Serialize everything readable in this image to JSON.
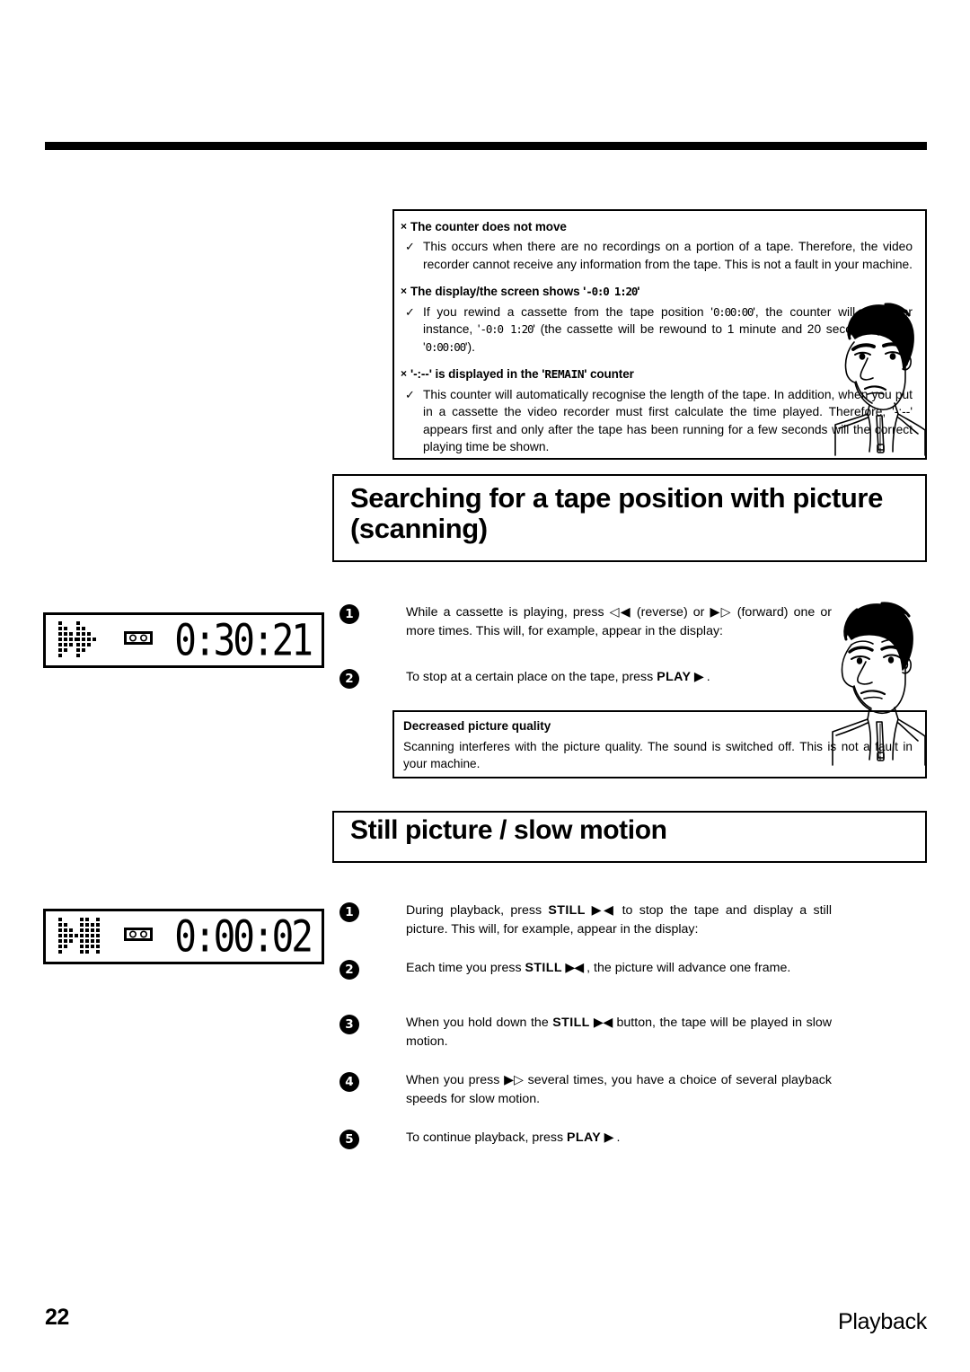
{
  "page": {
    "number": "22",
    "section_label": "Playback"
  },
  "tips_box": {
    "items": [
      {
        "marker": "×",
        "question": "The counter does not move",
        "check": "✓",
        "answer_parts": [
          {
            "type": "text",
            "text": "This occurs when there are no recordings on a portion of a tape. Therefore, the video recorder cannot receive any information from the tape. This is not a fault in your machine."
          }
        ]
      },
      {
        "marker": "×",
        "question_parts": [
          {
            "type": "text",
            "text": "The display/the screen shows '"
          },
          {
            "type": "seg",
            "text": "-0:0 1:20"
          },
          {
            "type": "text",
            "text": "'"
          }
        ],
        "check": "✓",
        "answer_parts": [
          {
            "type": "text",
            "text": "If you rewind a cassette from the tape position '"
          },
          {
            "type": "seg",
            "text": "0:00:00"
          },
          {
            "type": "text",
            "text": "', the counter will show for instance, '"
          },
          {
            "type": "seg",
            "text": "-0:0 1:20"
          },
          {
            "type": "text",
            "text": "' (the cassette will be rewound to 1 minute and 20 seconds before '"
          },
          {
            "type": "seg",
            "text": "0:00:00"
          },
          {
            "type": "text",
            "text": "')."
          }
        ]
      },
      {
        "marker": "×",
        "question_parts": [
          {
            "type": "text",
            "text": "'-:--' is displayed in the '"
          },
          {
            "type": "mono",
            "text": "REMAIN"
          },
          {
            "type": "text",
            "text": "' counter"
          }
        ],
        "check": "✓",
        "answer_parts": [
          {
            "type": "text",
            "text": "This counter will automatically recognise the length of the tape. In addition, when you put in a cassette the video recorder must first calculate the time played. Therefore, '-:--' appears first and only after the tape has been running for a few seconds will the correct playing time be shown."
          }
        ]
      }
    ]
  },
  "heading_scanning": {
    "line1": "Searching for a tape position with picture",
    "line2": "(scanning)",
    "full": "Searching for a tape position with picture (scanning)"
  },
  "scanning_steps": [
    {
      "number": "1",
      "parts": [
        {
          "type": "text",
          "text": "While a cassette is playing, press "
        },
        {
          "type": "glyph",
          "text": "◁◀"
        },
        {
          "type": "text",
          "text": " (reverse) or "
        },
        {
          "type": "glyph",
          "text": "▶▷"
        },
        {
          "type": "text",
          "text": " (forward) one or more times. This will, for example, appear in the display:"
        }
      ]
    },
    {
      "number": "2",
      "parts": [
        {
          "type": "text",
          "text": "To stop at a certain place on the tape, press "
        },
        {
          "type": "btn",
          "text": "PLAY"
        },
        {
          "type": "glyph",
          "text": " ▶"
        },
        {
          "type": "text",
          "text": " ."
        }
      ]
    }
  ],
  "quality_box": {
    "title": "Decreased picture quality",
    "text": "Scanning interferes with the picture quality. The sound is switched off. This is not a fault in your machine."
  },
  "heading_still": {
    "text": "Still picture / slow motion"
  },
  "still_steps": [
    {
      "number": "1",
      "parts": [
        {
          "type": "text",
          "text": "During playback, press  "
        },
        {
          "type": "btn",
          "text": "STILL"
        },
        {
          "type": "glyph",
          "text": " ▶◀"
        },
        {
          "type": "text",
          "text": " to stop the tape and display a still picture. This will, for example, appear in the display:"
        }
      ]
    },
    {
      "number": "2",
      "parts": [
        {
          "type": "text",
          "text": "Each time you press  "
        },
        {
          "type": "btn",
          "text": "STILL"
        },
        {
          "type": "glyph",
          "text": " ▶◀"
        },
        {
          "type": "text",
          "text": " , the picture will advance one frame."
        }
      ]
    },
    {
      "number": "3",
      "parts": [
        {
          "type": "text",
          "text": "When you hold down the  "
        },
        {
          "type": "btn",
          "text": "STILL"
        },
        {
          "type": "glyph",
          "text": " ▶◀"
        },
        {
          "type": "text",
          "text": " button, the tape will be played in slow motion."
        }
      ]
    },
    {
      "number": "4",
      "parts": [
        {
          "type": "text",
          "text": "When you press  "
        },
        {
          "type": "glyph",
          "text": "▶▷"
        },
        {
          "type": "text",
          "text": " several times, you have a choice of several playback speeds for slow motion."
        }
      ]
    },
    {
      "number": "5",
      "parts": [
        {
          "type": "text",
          "text": "To continue playback, press  "
        },
        {
          "type": "btn",
          "text": "PLAY"
        },
        {
          "type": "glyph",
          "text": " ▶"
        },
        {
          "type": "text",
          "text": " ."
        }
      ]
    }
  ],
  "vcr_displays": [
    {
      "icon": "fast-forward-dot-matrix",
      "cassette_icon": "cassette-icon",
      "time": "0:30:21"
    },
    {
      "icon": "still-play-pause-dot-matrix",
      "cassette_icon": "cassette-icon",
      "time": "0:00:02"
    }
  ],
  "cartoons": [
    {
      "name": "puzzled-man-illustration"
    },
    {
      "name": "thoughtful-man-illustration"
    }
  ],
  "colors": {
    "ink": "#000000",
    "paper": "#ffffff"
  }
}
